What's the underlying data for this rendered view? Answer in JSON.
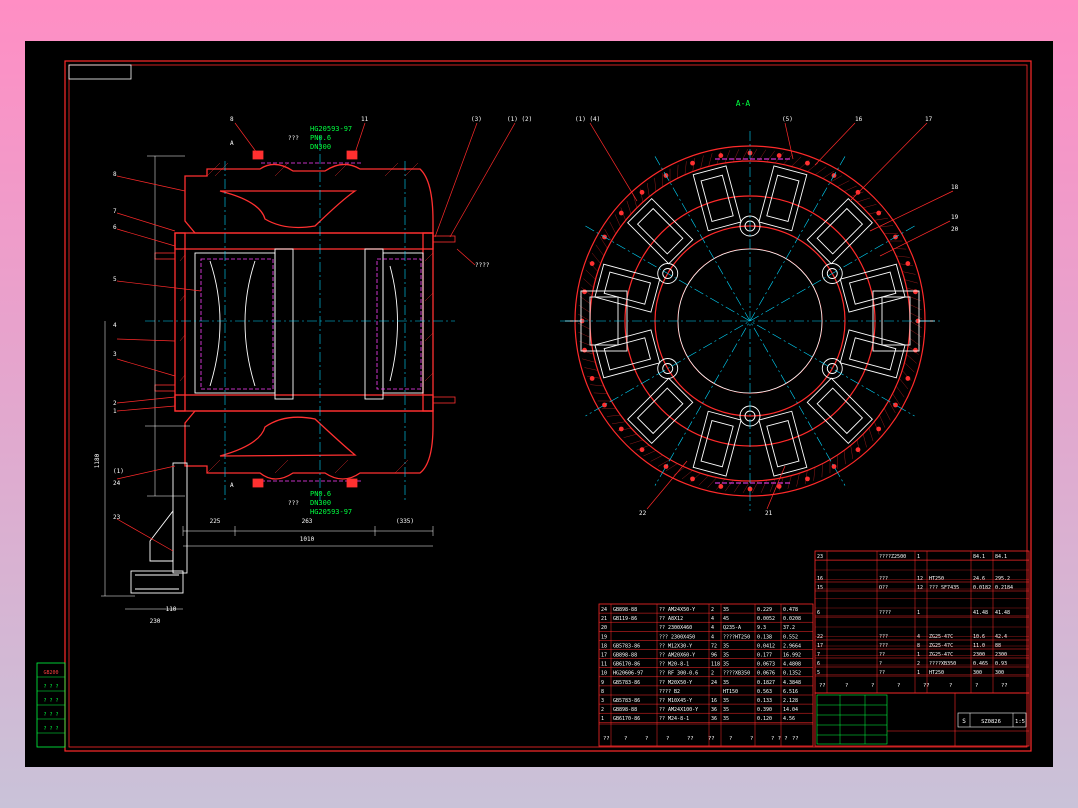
{
  "drawing": {
    "view_label": "A-A",
    "section_mark": "A",
    "spec_top": [
      "HG20593-97",
      "PN0.6",
      "DN300"
    ],
    "spec_bottom": [
      "PN0.6",
      "DN300",
      "HG20593-97"
    ],
    "unknown_label": "???",
    "leader_note": "????",
    "left_callouts": [
      "8",
      "7",
      "6",
      "5",
      "4",
      "3",
      "2",
      "1",
      "(1)",
      "24",
      "23"
    ],
    "top_callouts": [
      "8",
      "11",
      "(3)",
      "(1) (2)"
    ],
    "right_view_callouts": [
      "(1) (4)",
      "(5)",
      "16",
      "17",
      "18",
      "19",
      "20",
      "22",
      "21"
    ],
    "dimensions": {
      "d1": "225",
      "d2": "263",
      "d3": "(335)",
      "total": "1010",
      "base": "230",
      "base2": "110",
      "left_total": "1180"
    }
  },
  "parts_table": {
    "rows": [
      {
        "no": "24",
        "std": "GB898-88",
        "name": "?? AM24X50-Y",
        "qty": "2",
        "mat": "35",
        "w1": "0.229",
        "w2": "0.478"
      },
      {
        "no": "21",
        "std": "GB119-86",
        "name": "?? A8X12",
        "qty": "4",
        "mat": "45",
        "w1": "0.0052",
        "w2": "0.0208"
      },
      {
        "no": "20",
        "std": "",
        "name": "?? 2300X460",
        "qty": "4",
        "mat": "Q235-A",
        "w1": "9.3",
        "w2": "37.2"
      },
      {
        "no": "19",
        "std": "",
        "name": "??? 2300X450",
        "qty": "4",
        "mat": "????HT250",
        "w1": "0.138",
        "w2": "0.552"
      },
      {
        "no": "18",
        "std": "GB5783-86",
        "name": "?? M12X30-Y",
        "qty": "72",
        "mat": "35",
        "w1": "0.0412",
        "w2": "2.9664"
      },
      {
        "no": "17",
        "std": "GB898-88",
        "name": "?? AM20X60-Y",
        "qty": "96",
        "mat": "35",
        "w1": "0.177",
        "w2": "16.992"
      },
      {
        "no": "11",
        "std": "GB6170-86",
        "name": "?? M20-8-1",
        "qty": "118",
        "mat": "35",
        "w1": "0.0673",
        "w2": "4.4808"
      },
      {
        "no": "10",
        "std": "HG20606-97",
        "name": "?? RF 300-0.6",
        "qty": "2",
        "mat": "????XB350",
        "w1": "0.0676",
        "w2": "0.1352"
      },
      {
        "no": "9",
        "std": "GB5783-86",
        "name": "?? M20X50-Y",
        "qty": "24",
        "mat": "35",
        "w1": "0.1827",
        "w2": "4.3848"
      },
      {
        "no": "8",
        "std": "",
        "name": "???? B2",
        "qty": "",
        "mat": "HT150",
        "w1": "0.563",
        "w2": "6.516"
      },
      {
        "no": "3",
        "std": "GB5783-86",
        "name": "?? M10X45-Y",
        "qty": "16",
        "mat": "35",
        "w1": "0.133",
        "w2": "2.128"
      },
      {
        "no": "2",
        "std": "GB898-88",
        "name": "?? AM24X100-Y",
        "qty": "36",
        "mat": "35",
        "w1": "0.390",
        "w2": "14.04"
      },
      {
        "no": "1",
        "std": "GB6170-86",
        "name": "?? M24-8-1",
        "qty": "36",
        "mat": "35",
        "w1": "0.120",
        "w2": "4.56"
      }
    ],
    "footer": [
      "??",
      "?",
      "?",
      "?",
      "??",
      "??",
      "?",
      "?",
      "? ? ?",
      "??"
    ]
  },
  "right_table": {
    "rows": [
      {
        "no": "23",
        "name": "????Z2500",
        "qty": "1",
        "w1": "84.1",
        "w2": "84.1"
      },
      {
        "no": "16",
        "name": "???",
        "qty": "12",
        "mat": "HT250",
        "w1": "24.6",
        "w2": "295.2"
      },
      {
        "no": "15",
        "name": "O??",
        "qty": "12",
        "mat": "??? SF7435",
        "w1": "0.0182",
        "w2": "0.2184"
      },
      {
        "no": "6",
        "name": "????",
        "qty": "1",
        "w1": "41.48",
        "w2": "41.48"
      },
      {
        "no": "22",
        "name": "???",
        "qty": "4",
        "mat": "ZG25-47C",
        "w1": "10.6",
        "w2": "42.4"
      },
      {
        "no": "17",
        "name": "???",
        "qty": "8",
        "mat": "ZG25-47C",
        "w1": "11.0",
        "w2": "88"
      },
      {
        "no": "7",
        "name": "??",
        "qty": "1",
        "mat": "ZG25-47C",
        "w1": "2300",
        "w2": "2300"
      },
      {
        "no": "6",
        "name": "?",
        "qty": "2",
        "mat": "????XB350",
        "w1": "0.465",
        "w2": "0.93"
      },
      {
        "no": "5",
        "name": "??",
        "qty": "1",
        "mat": "HT250",
        "w1": "300",
        "w2": "300"
      }
    ],
    "header": [
      "??",
      "?",
      "?",
      "?",
      "??",
      "?",
      "?",
      "??"
    ]
  },
  "title_block": {
    "scale_label": "S",
    "drawing_no": "SZ0826",
    "sheet": "1:5"
  },
  "revision_block": {
    "label": "GB200",
    "rows": [
      "? ? ?",
      "? ? ?",
      "? ? ?",
      "? ? ?"
    ]
  }
}
